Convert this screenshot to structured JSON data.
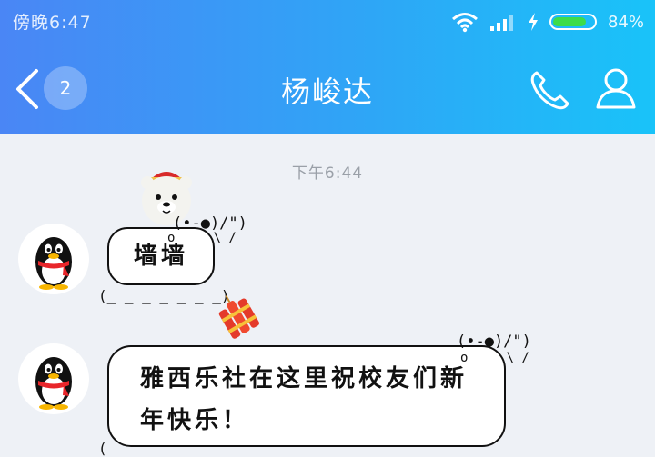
{
  "status_bar": {
    "time": "傍晚6:47",
    "battery_percent": "84%",
    "battery_level": 0.84,
    "battery_color": "#3ddc4a"
  },
  "header": {
    "back_count": "2",
    "title": "杨峻达",
    "gradient_start": "#4a86f5",
    "gradient_end": "#19c3f9",
    "icons": [
      "chevron-left-icon",
      "phone-icon",
      "person-icon"
    ]
  },
  "chat": {
    "timestamp": "下午6:44",
    "messages": [
      {
        "text": "墙墙",
        "sender_avatar": "qq-penguin"
      },
      {
        "text": "雅西乐社在这里祝校友们新年快乐！",
        "sender_avatar": "qq-penguin"
      }
    ]
  }
}
